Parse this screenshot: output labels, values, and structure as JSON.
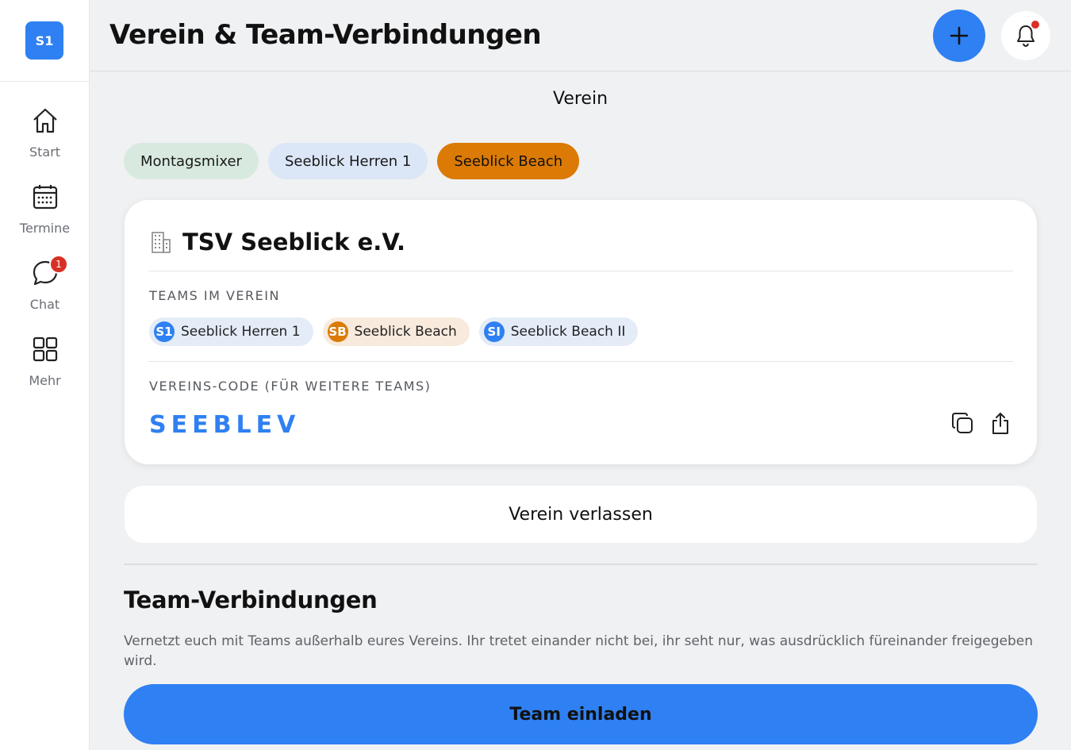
{
  "sidebar": {
    "logo_text": "S1",
    "items": [
      {
        "label": "Start",
        "icon": "home-icon"
      },
      {
        "label": "Termine",
        "icon": "calendar-icon"
      },
      {
        "label": "Chat",
        "icon": "chat-icon",
        "badge": "1"
      },
      {
        "label": "Mehr",
        "icon": "grid-icon"
      }
    ]
  },
  "header": {
    "title": "Verein & Team-Verbindungen",
    "add_icon": "plus-icon",
    "bell_icon": "bell-icon"
  },
  "verein": {
    "section_title": "Verein",
    "team_tabs": [
      {
        "label": "Montagsmixer",
        "color": "#d8eadf"
      },
      {
        "label": "Seeblick Herren 1",
        "color": "#dbe6f7"
      },
      {
        "label": "Seeblick Beach",
        "color": "#db7a05",
        "selected": true
      }
    ],
    "club": {
      "name": "TSV Seeblick e.V.",
      "icon": "building-icon",
      "teams_caption": "TEAMS IM VEREIN",
      "teams": [
        {
          "avatar": "S1",
          "name": "Seeblick Herren 1",
          "color": "#2f80f2"
        },
        {
          "avatar": "SB",
          "name": "Seeblick Beach",
          "color": "#db7a05"
        },
        {
          "avatar": "SI",
          "name": "Seeblick Beach II",
          "color": "#2f80f2"
        }
      ],
      "code_caption": "VEREINS-CODE (FÜR WEITERE TEAMS)",
      "code": "SEEBLEV",
      "copy_icon": "copy-icon",
      "share_icon": "share-icon"
    },
    "leave_label": "Verein verlassen"
  },
  "connections": {
    "title": "Team-Verbindungen",
    "description": "Vernetzt euch mit Teams außerhalb eures Vereins. Ihr tretet einander nicht bei, ihr seht nur, was ausdrücklich füreinander freigegeben wird.",
    "invite_label": "Team einladen"
  },
  "colors": {
    "accent": "#2f80f2",
    "orange": "#db7a05",
    "badge": "#d93025"
  }
}
